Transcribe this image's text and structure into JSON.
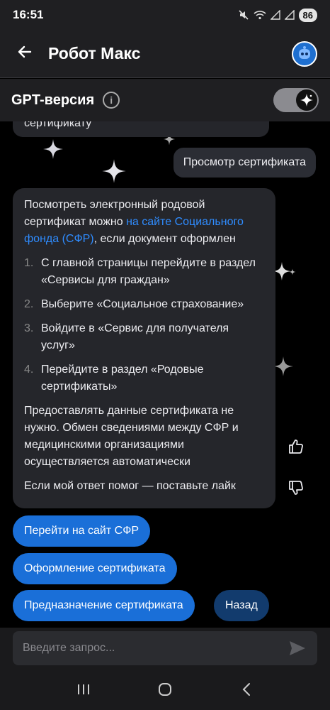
{
  "status": {
    "time": "16:51",
    "battery": "86"
  },
  "header": {
    "title": "Робот Макс"
  },
  "gpt": {
    "label": "GPT-версия",
    "info_glyph": "i",
    "enabled": true
  },
  "messages": {
    "prev_bot_tail": "сертификату",
    "user": "Просмотр сертификата",
    "bot": {
      "intro_before_link": "Посмотреть электронный родовой сертификат можно ",
      "link": "на сайте Социального фонда (СФР)",
      "intro_after_link": ", если документ оформлен",
      "steps": [
        {
          "num": "1.",
          "text": "С главной страницы перейдите в раздел «Сервисы для граждан»"
        },
        {
          "num": "2.",
          "text": "Выберите «Социальное страхование»"
        },
        {
          "num": "3.",
          "text": "Войдите в «Сервис для получателя услуг»"
        },
        {
          "num": "4.",
          "text": "Перейдите в раздел «Родовые сертификаты»"
        }
      ],
      "paragraph": "Предоставлять данные сертификата не нужно. Обмен сведениями между СФР и медицинскими организациями осуществляется автоматически",
      "like_prompt": "Если мой ответ помог — поставьте лайк"
    }
  },
  "chips": {
    "sfr_site": "Перейти на сайт СФР",
    "registration": "Оформление сертификата",
    "purpose": "Предназначение сертификата",
    "back": "Назад"
  },
  "input": {
    "placeholder": "Введите запрос..."
  },
  "colors": {
    "accent": "#1a6fd8",
    "link": "#2f8cff",
    "bubble": "#25262b",
    "background": "#000000"
  },
  "icons": [
    "back-arrow-icon",
    "info-icon",
    "sparkle-icon",
    "thumbs-up-icon",
    "thumbs-down-icon",
    "send-icon",
    "recents-icon",
    "home-icon",
    "nav-back-icon",
    "mute-icon",
    "wifi-icon",
    "signal-icon"
  ]
}
